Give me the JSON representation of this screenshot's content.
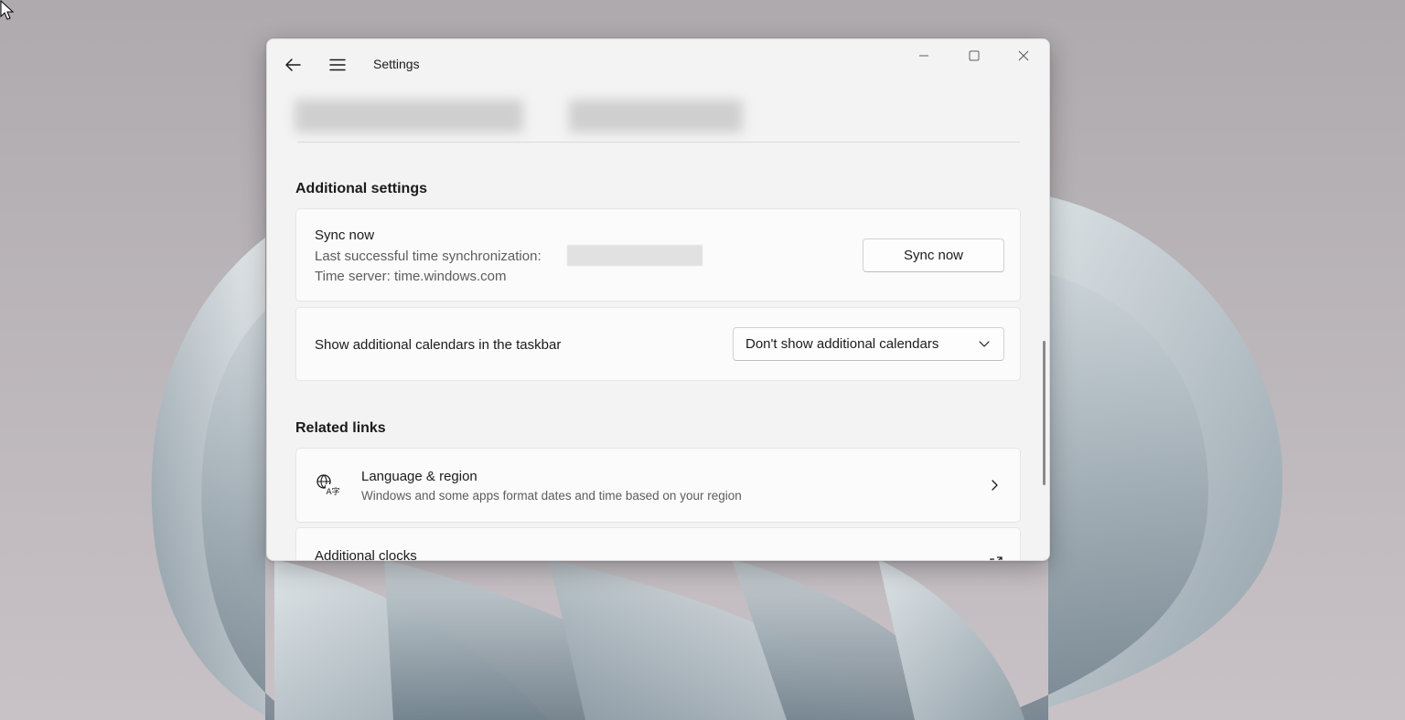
{
  "window": {
    "app_title": "Settings"
  },
  "additional_settings": {
    "heading": "Additional settings",
    "sync": {
      "title": "Sync now",
      "last_sync_label": "Last successful time synchronization:",
      "time_server": "Time server: time.windows.com",
      "button_label": "Sync now"
    },
    "calendars": {
      "label": "Show additional calendars in the taskbar",
      "selected_option": "Don't show additional calendars"
    }
  },
  "related_links": {
    "heading": "Related links",
    "items": [
      {
        "title": "Language & region",
        "subtitle": "Windows and some apps format dates and time based on your region",
        "icon": "language-region-icon"
      },
      {
        "title": "Additional clocks",
        "icon": "open-external-icon"
      }
    ]
  },
  "colors": {
    "window_bg": "#f3f3f3",
    "card_bg": "#fbfbfb",
    "text_primary": "#1b1b1b",
    "text_secondary": "#5d5d5d"
  }
}
